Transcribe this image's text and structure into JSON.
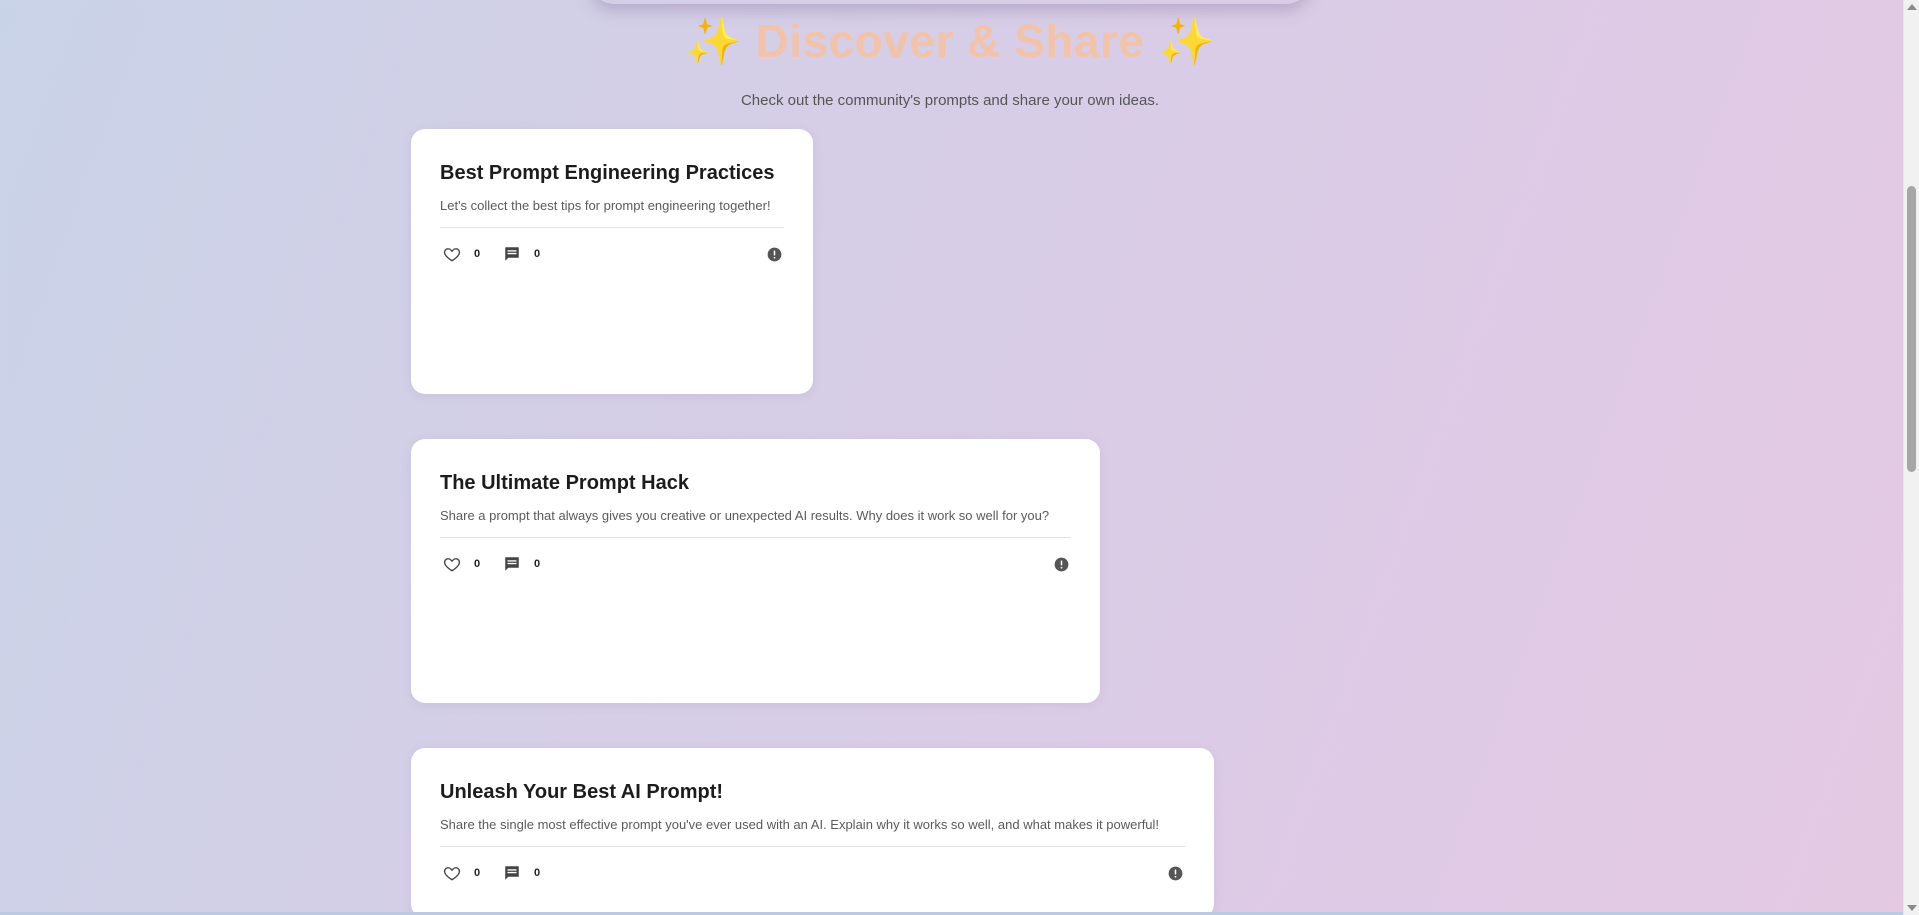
{
  "hero": {
    "sparkle_left": "✨",
    "title": "Discover & Share",
    "sparkle_right": "✨",
    "subtitle": "Check out the community's prompts and share your own ideas."
  },
  "cards": [
    {
      "title": "Best Prompt Engineering Practices",
      "description": "Let's collect the best tips for prompt engineering together!",
      "likes": "0",
      "comments": "0"
    },
    {
      "title": "The Ultimate Prompt Hack",
      "description": "Share a prompt that always gives you creative or unexpected AI results. Why does it work so well for you?",
      "likes": "0",
      "comments": "0"
    },
    {
      "title": "Unleash Your Best AI Prompt!",
      "description": "Share the single most effective prompt you've ever used with an AI. Explain why it works so well, and what makes it powerful!",
      "likes": "0",
      "comments": "0"
    }
  ],
  "icons": {
    "like": "heart-outline-icon",
    "comment": "comment-icon",
    "report": "alert-circle-icon"
  },
  "colors": {
    "title_accent": "#f2c3a8",
    "sparkle": "#f6c27a",
    "card_bg": "#ffffff"
  }
}
